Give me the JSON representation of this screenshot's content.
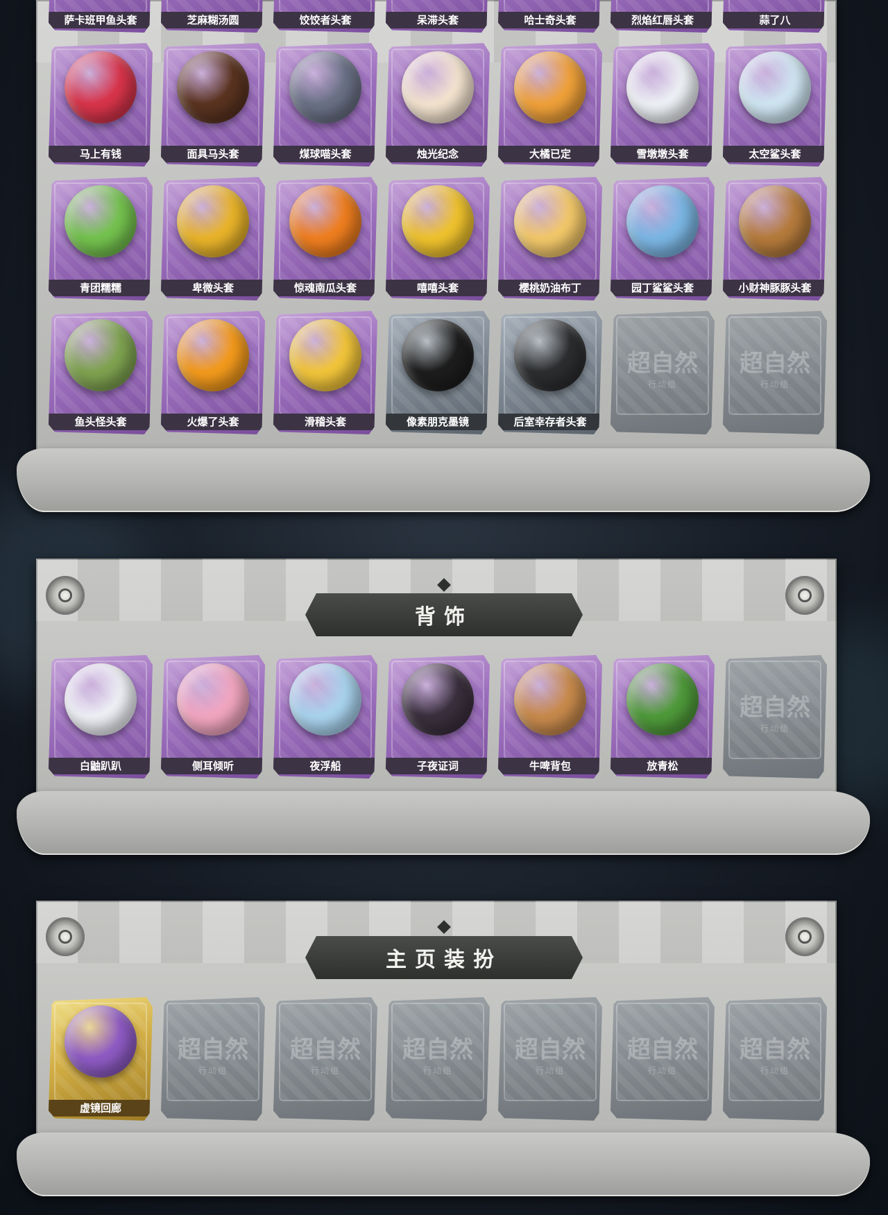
{
  "colors": {
    "rare_purple": "#9c6fbd",
    "uncommon_grey": "#7d8792",
    "legendary_gold": "#d2ae45",
    "panel_stone": "#c4c5c2",
    "banner_dark": "#3a3c3a"
  },
  "headwear": {
    "rows": [
      [
        {
          "name": "萨卡班甲鱼头套",
          "rarity": "purple",
          "icon": "fish-head-icon",
          "hue": "#c9b48a"
        },
        {
          "name": "芝麻糊汤圆",
          "rarity": "purple",
          "icon": "rice-ball-icon",
          "hue": "#e8e2d5"
        },
        {
          "name": "饺饺者头套",
          "rarity": "purple",
          "icon": "dumpling-icon",
          "hue": "#efe8d6"
        },
        {
          "name": "呆滞头套",
          "rarity": "purple",
          "icon": "blank-face-icon",
          "hue": "#e9c34a"
        },
        {
          "name": "哈士奇头套",
          "rarity": "purple",
          "icon": "husky-icon",
          "hue": "#b9b4ad"
        },
        {
          "name": "烈焰红唇头套",
          "rarity": "purple",
          "icon": "red-lips-icon",
          "hue": "#d9574c"
        },
        {
          "name": "蒜了八",
          "rarity": "purple",
          "icon": "garlic-icon",
          "hue": "#ece7dc"
        }
      ],
      [
        {
          "name": "马上有钱",
          "rarity": "purple",
          "icon": "red-horse-icon",
          "hue": "#d8344a"
        },
        {
          "name": "面具马头套",
          "rarity": "purple",
          "icon": "horse-mask-icon",
          "hue": "#5a3320"
        },
        {
          "name": "煤球喵头套",
          "rarity": "purple",
          "icon": "grey-cat-icon",
          "hue": "#6a7186"
        },
        {
          "name": "烛光纪念",
          "rarity": "purple",
          "icon": "candle-icon",
          "hue": "#f3e3cf"
        },
        {
          "name": "大橘已定",
          "rarity": "purple",
          "icon": "orange-slice-icon",
          "hue": "#f0a13a"
        },
        {
          "name": "雪墩墩头套",
          "rarity": "purple",
          "icon": "snowman-icon",
          "hue": "#eef1f5"
        },
        {
          "name": "太空鲨头套",
          "rarity": "purple",
          "icon": "shark-egg-icon",
          "hue": "#cfe6f2"
        }
      ],
      [
        {
          "name": "青团糯糯",
          "rarity": "purple",
          "icon": "green-bun-icon",
          "hue": "#74c24e"
        },
        {
          "name": "卑微头套",
          "rarity": "purple",
          "icon": "humble-face-icon",
          "hue": "#e9b42a"
        },
        {
          "name": "惊魂南瓜头套",
          "rarity": "purple",
          "icon": "pumpkin-icon",
          "hue": "#ef7e1f"
        },
        {
          "name": "嘻嘻头套",
          "rarity": "purple",
          "icon": "grin-face-icon",
          "hue": "#efc22d"
        },
        {
          "name": "樱桃奶油布丁",
          "rarity": "purple",
          "icon": "pudding-icon",
          "hue": "#f3c86a"
        },
        {
          "name": "园丁鲨鲨头套",
          "rarity": "purple",
          "icon": "gardener-shark-icon",
          "hue": "#7bb6e3"
        },
        {
          "name": "小财神豚豚头套",
          "rarity": "purple",
          "icon": "capybara-icon",
          "hue": "#b57b3c"
        }
      ],
      [
        {
          "name": "鱼头怪头套",
          "rarity": "purple",
          "icon": "fish-man-icon",
          "hue": "#7fa350"
        },
        {
          "name": "火爆了头套",
          "rarity": "purple",
          "icon": "fire-spirit-icon",
          "hue": "#f39a1c"
        },
        {
          "name": "滑稽头套",
          "rarity": "purple",
          "icon": "smirk-face-icon",
          "hue": "#f2c53a"
        },
        {
          "name": "像素朋克墨镜",
          "rarity": "grey",
          "icon": "pixel-sunglasses-icon",
          "hue": "#1d1d1d"
        },
        {
          "name": "后室幸存者头套",
          "rarity": "grey",
          "icon": "gas-mask-icon",
          "hue": "#2c2d2f"
        },
        {
          "name": "",
          "rarity": "empty",
          "icon": "placeholder-icon",
          "hue": ""
        },
        {
          "name": "",
          "rarity": "empty",
          "icon": "placeholder-icon",
          "hue": ""
        }
      ]
    ]
  },
  "back_accessory": {
    "title": "背饰",
    "items": [
      {
        "name": "白鼬趴趴",
        "rarity": "purple",
        "icon": "white-ferret-icon",
        "hue": "#eef0f5"
      },
      {
        "name": "侧耳倾听",
        "rarity": "purple",
        "icon": "flower-wreath-icon",
        "hue": "#f2a6c0"
      },
      {
        "name": "夜浮船",
        "rarity": "purple",
        "icon": "jellyfish-icon",
        "hue": "#a9d3ee"
      },
      {
        "name": "子夜证词",
        "rarity": "purple",
        "icon": "crow-doll-icon",
        "hue": "#3a2f3d"
      },
      {
        "name": "牛啤背包",
        "rarity": "purple",
        "icon": "cow-barrel-icon",
        "hue": "#c88a4c"
      },
      {
        "name": "放青松",
        "rarity": "purple",
        "icon": "bonsai-icon",
        "hue": "#4f9a3a"
      },
      {
        "name": "",
        "rarity": "empty",
        "icon": "placeholder-icon",
        "hue": ""
      }
    ]
  },
  "homepage": {
    "title": "主页装扮",
    "items": [
      {
        "name": "虚镜回廊",
        "rarity": "gold",
        "icon": "mirror-card-icon",
        "hue": "#8e5bc4"
      },
      {
        "name": "",
        "rarity": "empty",
        "icon": "placeholder-icon",
        "hue": ""
      },
      {
        "name": "",
        "rarity": "empty",
        "icon": "placeholder-icon",
        "hue": ""
      },
      {
        "name": "",
        "rarity": "empty",
        "icon": "placeholder-icon",
        "hue": ""
      },
      {
        "name": "",
        "rarity": "empty",
        "icon": "placeholder-icon",
        "hue": ""
      },
      {
        "name": "",
        "rarity": "empty",
        "icon": "placeholder-icon",
        "hue": ""
      },
      {
        "name": "",
        "rarity": "empty",
        "icon": "placeholder-icon",
        "hue": ""
      }
    ]
  },
  "placeholder": {
    "big": "超自然",
    "small": "行动组"
  }
}
